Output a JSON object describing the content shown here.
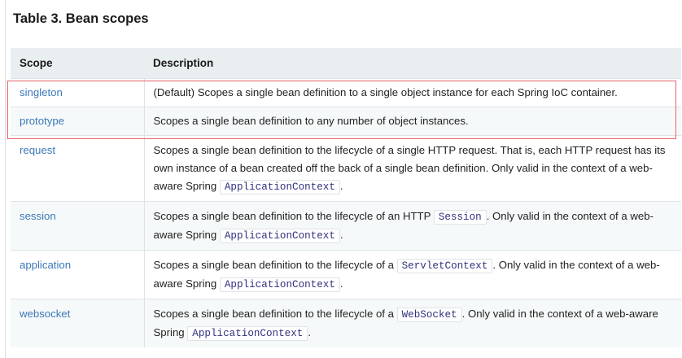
{
  "table": {
    "title": "Table 3. Bean scopes",
    "headers": {
      "scope": "Scope",
      "description": "Description"
    },
    "rows": [
      {
        "scope": "singleton",
        "desc_before": "(Default) Scopes a single bean definition to a single object instance for each Spring IoC container.",
        "code1": "",
        "desc_mid": "",
        "code2": "",
        "desc_after": ""
      },
      {
        "scope": "prototype",
        "desc_before": "Scopes a single bean definition to any number of object instances.",
        "code1": "",
        "desc_mid": "",
        "code2": "",
        "desc_after": ""
      },
      {
        "scope": "request",
        "desc_before": "Scopes a single bean definition to the lifecycle of a single HTTP request. That is, each HTTP request has its own instance of a bean created off the back of a single bean definition. Only valid in the context of a web-aware Spring ",
        "code1": "ApplicationContext",
        "desc_mid": ".",
        "code2": "",
        "desc_after": ""
      },
      {
        "scope": "session",
        "desc_before": "Scopes a single bean definition to the lifecycle of an HTTP ",
        "code1": "Session",
        "desc_mid": ". Only valid in the context of a web-aware Spring ",
        "code2": "ApplicationContext",
        "desc_after": "."
      },
      {
        "scope": "application",
        "desc_before": "Scopes a single bean definition to the lifecycle of a ",
        "code1": "ServletContext",
        "desc_mid": ". Only valid in the context of a web-aware Spring ",
        "code2": "ApplicationContext",
        "desc_after": "."
      },
      {
        "scope": "websocket",
        "desc_before": "Scopes a single bean definition to the lifecycle of a ",
        "code1": "WebSocket",
        "desc_mid": ". Only valid in the context of a web-aware Spring ",
        "code2": "ApplicationContext",
        "desc_after": "."
      }
    ]
  },
  "colors": {
    "scope_link": "#3b78b8",
    "code_text": "#30317e",
    "header_bg": "#e9eef0",
    "highlight_border": "#e8636b"
  }
}
